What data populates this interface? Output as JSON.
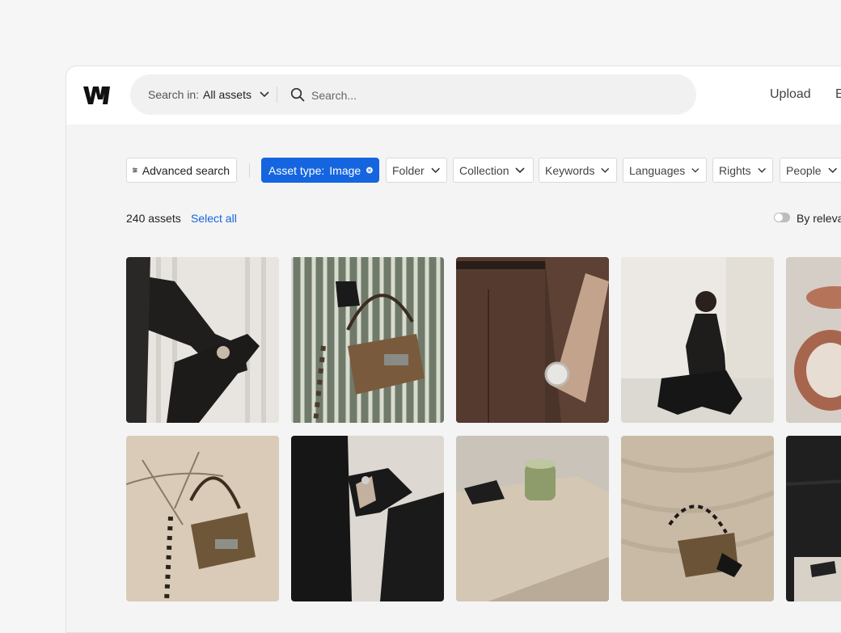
{
  "header": {
    "search_scope_label": "Search in:",
    "search_scope_value": "All assets",
    "search_placeholder": "Search...",
    "upload_label": "Upload",
    "truncated_label": "E"
  },
  "filters": {
    "advanced_search_label": "Advanced search",
    "active_filter": {
      "label": "Asset type:",
      "value": "Image"
    },
    "dropdowns": [
      "Folder",
      "Collection",
      "Keywords",
      "Languages",
      "Rights",
      "People"
    ]
  },
  "results": {
    "count_label": "240 assets",
    "select_all_label": "Select all",
    "sort_label": "By relevan"
  },
  "assets": [
    {
      "name": "black-blazer-arm-boot"
    },
    {
      "name": "suede-bag-on-striped-fabric"
    },
    {
      "name": "brown-suit-wristwatch"
    },
    {
      "name": "woman-black-outfit-seated"
    },
    {
      "name": "copper-bowls"
    },
    {
      "name": "suede-bag-in-sand"
    },
    {
      "name": "black-leather-boots"
    },
    {
      "name": "candle-on-travertine-block"
    },
    {
      "name": "suede-bag-on-sand"
    },
    {
      "name": "black-leather-sofa"
    }
  ],
  "colors": {
    "accent": "#1565e0",
    "background": "#f4f4f4",
    "chip_border": "#d9d9d9"
  }
}
